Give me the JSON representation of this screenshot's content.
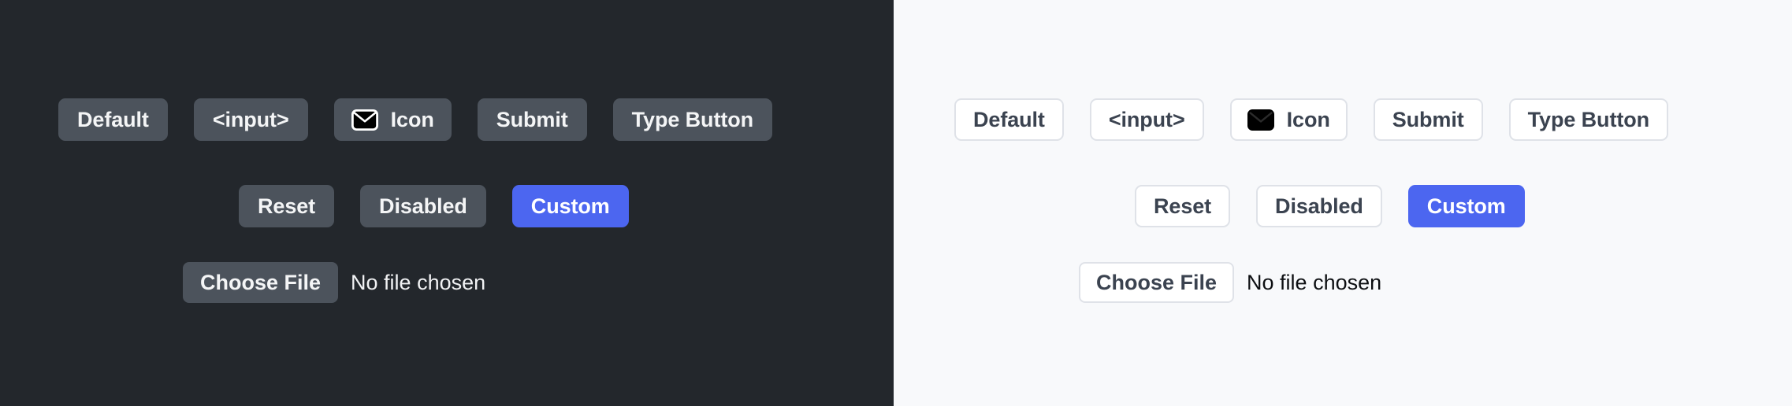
{
  "panels": [
    {
      "theme": "dark",
      "background": "#23272c",
      "rows": [
        {
          "name": "primary-button-row",
          "buttons": [
            {
              "label": "Default",
              "kind": "default"
            },
            {
              "label": "<input>",
              "kind": "input"
            },
            {
              "label": "Icon",
              "kind": "icon",
              "icon": "envelope-icon"
            },
            {
              "label": "Submit",
              "kind": "submit"
            },
            {
              "label": "Type Button",
              "kind": "type-button"
            }
          ]
        },
        {
          "name": "secondary-button-row",
          "buttons": [
            {
              "label": "Reset",
              "kind": "reset"
            },
            {
              "label": "Disabled",
              "kind": "disabled"
            },
            {
              "label": "Custom",
              "kind": "custom"
            }
          ]
        }
      ],
      "file_input": {
        "button_label": "Choose File",
        "status_text": "No file chosen"
      }
    },
    {
      "theme": "light",
      "background": "#f8f9fb",
      "rows": [
        {
          "name": "primary-button-row",
          "buttons": [
            {
              "label": "Default",
              "kind": "default"
            },
            {
              "label": "<input>",
              "kind": "input"
            },
            {
              "label": "Icon",
              "kind": "icon",
              "icon": "envelope-icon"
            },
            {
              "label": "Submit",
              "kind": "submit"
            },
            {
              "label": "Type Button",
              "kind": "type-button"
            }
          ]
        },
        {
          "name": "secondary-button-row",
          "buttons": [
            {
              "label": "Reset",
              "kind": "reset"
            },
            {
              "label": "Disabled",
              "kind": "disabled"
            },
            {
              "label": "Custom",
              "kind": "custom"
            }
          ]
        }
      ],
      "file_input": {
        "button_label": "Choose File",
        "status_text": "No file chosen"
      }
    }
  ],
  "colors": {
    "dark_background": "#23272c",
    "dark_button_fill": "#4c535c",
    "dark_button_text": "#f4f5f6",
    "light_background": "#f8f9fb",
    "light_button_fill": "#ffffff",
    "light_button_border": "#dfe2e8",
    "light_button_text": "#3b4350",
    "custom_accent": "#4c66f0",
    "icon_color": "#000000"
  }
}
